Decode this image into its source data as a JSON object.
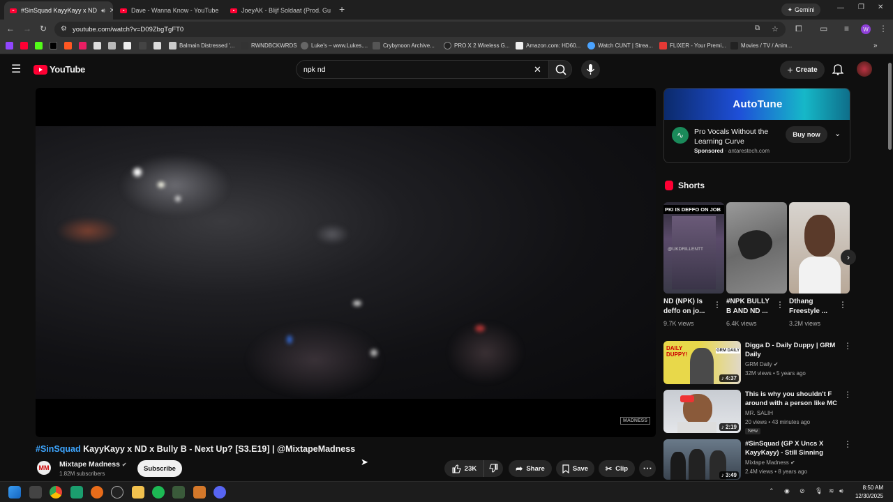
{
  "browser": {
    "tabs": [
      {
        "title": "#SinSquad KayyKayy x ND",
        "active": true
      },
      {
        "title": "Dave - Wanna Know - YouTube",
        "active": false
      },
      {
        "title": "JoeyAK - Blijf Soldaat (Prod. Gu",
        "active": false
      }
    ],
    "gemini_label": "Gemini",
    "url": "youtube.com/watch?v=D09ZbgTgFT0",
    "profile_initial": "W",
    "bookmarks": [
      "Balmain Distressed '...",
      "RWNDBCKWRDS",
      "Luke's – www.Lukes....",
      "Crybynoon Archive...",
      "PRO X 2 Wireless G...",
      "Amazon.com: HD60...",
      "Watch CUNT | Strea...",
      "FLIXER - Your Premi...",
      "Movies / TV / Anim..."
    ]
  },
  "youtube": {
    "logo_text": "YouTube",
    "search_query": "npk nd",
    "create_label": "Create",
    "video": {
      "watermark": "MADNESS",
      "title_hashtag": "#SinSquad",
      "title_rest": " KayyKayy x ND x Bully B - Next Up? [S3.E19] | @MixtapeMadness",
      "channel_name": "Mixtape Madness",
      "channel_avatar": "MM",
      "subscribers": "1.82M subscribers",
      "subscribe_label": "Subscribe",
      "likes": "23K",
      "share_label": "Share",
      "save_label": "Save",
      "clip_label": "Clip"
    },
    "ad": {
      "banner_text": "AutoTune",
      "headline": "Pro Vocals Without the Learning Curve",
      "sponsored": "Sponsored",
      "domain": "antarestech.com",
      "buy_label": "Buy now"
    },
    "shorts_heading": "Shorts",
    "shorts": [
      {
        "title": "ND (NPK) Is deffo on jo...",
        "views": "9.7K views",
        "thumb_text": "PKI IS DEFFO ON JOB",
        "thumb_watermark": "@UKDRILLENTT"
      },
      {
        "title": "#NPK BULLY B AND ND ...",
        "views": "6.4K views"
      },
      {
        "title": "Dthang Freestyle ...",
        "views": "3.2M views"
      }
    ],
    "recommendations": [
      {
        "title": "Digga D - Daily Duppy | GRM Daily",
        "channel": "GRM Daily",
        "views": "32M views",
        "age": "5 years ago",
        "duration": "4:37",
        "verified": true,
        "thumb_text": "DAILY DUPPY!",
        "thumb_badge": "GRM DAILY"
      },
      {
        "title": "This is why you shouldn't F around with a person like MC ...",
        "channel": "MR. SALIH",
        "views": "20 views",
        "age": "43 minutes ago",
        "duration": "2:19",
        "verified": false,
        "badge": "New"
      },
      {
        "title": "#SinSquad (GP X Uncs X KayyKayy) - Still Sinning (Musi...",
        "channel": "Mixtape Madness",
        "views": "2.4M views",
        "age": "8 years ago",
        "duration": "3:49",
        "verified": true
      }
    ]
  },
  "taskbar": {
    "time": "8:50 AM",
    "date": "12/30/2025"
  }
}
